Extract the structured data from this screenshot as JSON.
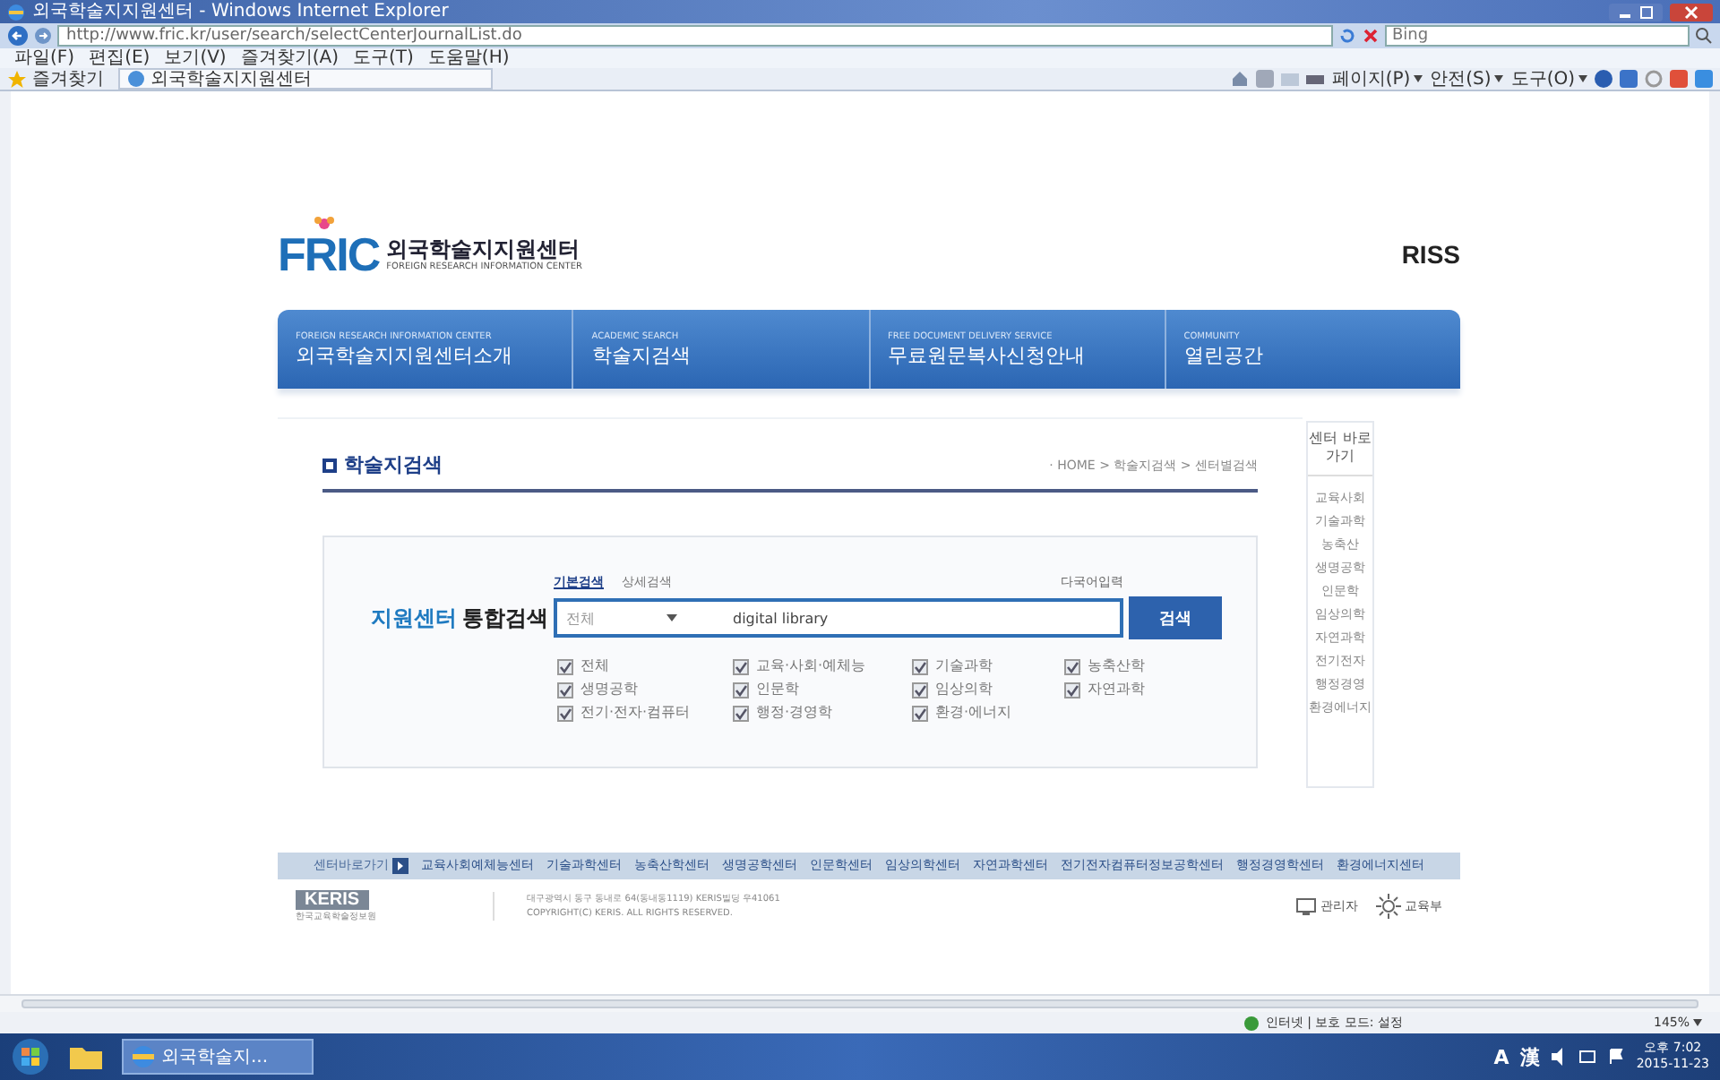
{
  "window": {
    "title": "외국학술지지원센터 - Windows Internet Explorer"
  },
  "address_bar": {
    "url": "http://www.fric.kr/user/search/selectCenterJournalList.do",
    "search_placeholder": "Bing"
  },
  "menu": [
    "파일(F)",
    "편집(E)",
    "보기(V)",
    "즐겨찾기(A)",
    "도구(T)",
    "도움말(H)"
  ],
  "favorites_bar": {
    "label": "즐겨찾기",
    "tab": "외국학술지지원센터",
    "tools": [
      "페이지(P)",
      "안전(S)",
      "도구(O)"
    ]
  },
  "site": {
    "logo_mark": "FRIC",
    "logo_name": "외국학술지지원센터",
    "logo_sub": "FOREIGN RESEARCH INFORMATION CENTER",
    "partner": "RISS",
    "nav": [
      {
        "caption": "FOREIGN RESEARCH INFORMATION CENTER",
        "label": "외국학술지지원센터소개"
      },
      {
        "caption": "ACADEMIC SEARCH",
        "label": "학술지검색"
      },
      {
        "caption": "FREE DOCUMENT DELIVERY SERVICE",
        "label": "무료원문복사신청안내"
      },
      {
        "caption": "COMMUNITY",
        "label": "열린공간"
      }
    ],
    "heading": "학술지검색",
    "breadcrumb": "· HOME > 학술지검색 > 센터별검색",
    "search": {
      "tabs": [
        {
          "label": "기본검색",
          "selected": true
        },
        {
          "label": "상세검색",
          "selected": false
        }
      ],
      "multilang": "다국어입력",
      "label_accent": "지원센터",
      "label": "통합검색",
      "scope": "전체",
      "value": "digital library",
      "button": "검색",
      "categories": [
        {
          "label": "전체",
          "checked": true
        },
        {
          "label": "교육·사회·예체능",
          "checked": true
        },
        {
          "label": "기술과학",
          "checked": true
        },
        {
          "label": "농축산학",
          "checked": true
        },
        {
          "label": "생명공학",
          "checked": true
        },
        {
          "label": "인문학",
          "checked": true
        },
        {
          "label": "임상의학",
          "checked": true
        },
        {
          "label": "자연과학",
          "checked": true
        },
        {
          "label": "전기·전자·컴퓨터",
          "checked": true
        },
        {
          "label": "행정·경영학",
          "checked": true
        },
        {
          "label": "환경·에너지",
          "checked": true
        }
      ]
    },
    "quick_links": {
      "title": "센터 바로가기",
      "items": [
        "교육사회",
        "기술과학",
        "농축산",
        "생명공학",
        "인문학",
        "임상의학",
        "자연과학",
        "전기전자",
        "행정경영",
        "환경에너지"
      ]
    },
    "footer_links": {
      "title": "센터바로가기",
      "items": [
        "교육사회예체능센터",
        "기술과학센터",
        "농축산학센터",
        "생명공학센터",
        "인문학센터",
        "임상의학센터",
        "자연과학센터",
        "전기전자컴퓨터정보공학센터",
        "행정경영학센터",
        "환경에너지센터"
      ]
    },
    "footer": {
      "org": "KERIS",
      "org_sub": "한국교육학술정보원",
      "address": "대구광역시 동구 동내로 64(동내동1119) KERIS빌딩 우41061",
      "copyright": "COPYRIGHT(C) KERIS. ALL RIGHTS RESERVED.",
      "admin": "관리자",
      "ministry": "교육부"
    }
  },
  "status_bar": {
    "zone": "인터넷 | 보호 모드: 설정",
    "zoom": "145%"
  },
  "taskbar": {
    "window": "외국학술지...",
    "ime": [
      "A",
      "漢"
    ],
    "time": "오후 7:02",
    "date": "2015-11-23"
  }
}
